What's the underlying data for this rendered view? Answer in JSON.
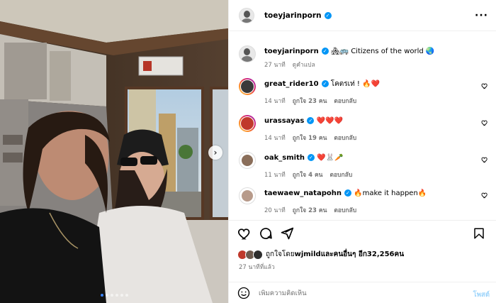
{
  "header": {
    "username": "toeyjarinporn",
    "verified_glyph": "✓",
    "more_icon": "more-horizontal-icon"
  },
  "caption": {
    "username": "toeyjarinporn",
    "text": "🏘🚌 Citizens of the world 🌏",
    "time": "27 นาที",
    "translate": "ดูคำแปล"
  },
  "comments": [
    {
      "username": "great_rider10",
      "text": "โคตรเท่ ! 🔥❤️",
      "time": "14 นาที",
      "likes": "ถูกใจ 23 คน",
      "reply": "ตอบกลับ",
      "avatar_color": "#3a3a3a"
    },
    {
      "username": "urassayas",
      "text": "❤️❤️❤️",
      "time": "14 นาที",
      "likes": "ถูกใจ 19 คน",
      "reply": "ตอบกลับ",
      "avatar_color": "#c0392b"
    },
    {
      "username": "oak_smith",
      "text": "❤️🐰🥕",
      "time": "11 นาที",
      "likes": "ถูกใจ 4 คน",
      "reply": "ตอบกลับ",
      "avatar_color": "#8a6e5a"
    },
    {
      "username": "taewaew_natapohn",
      "text": "🔥make it happen🔥",
      "time": "20 นาที",
      "likes": "ถูกใจ 23 คน",
      "reply": "ตอบกลับ",
      "avatar_color": "#b79a8a"
    }
  ],
  "likes_line": {
    "prefix": "ถูกใจโดย ",
    "user": "wjmild",
    "middle": " และคนอื่นๆ อีก ",
    "count": "32,256",
    "suffix": " คน"
  },
  "post_time": "27 นาทีที่แล้ว",
  "add_comment": {
    "placeholder": "เพิ่มความคิดเห็น",
    "post_label": "โพสต์"
  },
  "carousel": {
    "slide_count": 6,
    "active_index": 0
  },
  "colors": {
    "verified": "#0095f6",
    "like_red": "#ed4956",
    "post_disabled": "#9fd5fb",
    "meta_grey": "#737373"
  }
}
